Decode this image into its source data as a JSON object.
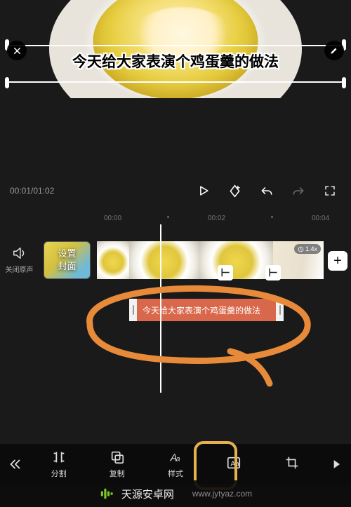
{
  "preview": {
    "subtitle_text": "今天给大家表演个鸡蛋羹的做法",
    "close_icon": "close-icon",
    "edit_icon": "pencil-icon"
  },
  "transport": {
    "current_time": "00:01",
    "total_time": "01:02",
    "separator": "/"
  },
  "ruler": {
    "marks": [
      "00:00",
      "00:02",
      "00:04"
    ]
  },
  "sound": {
    "label": "关闭原声"
  },
  "cover": {
    "label": "设置\n封面"
  },
  "clips": {
    "speed_badge": "1.4x"
  },
  "text_track": {
    "text": "今天给大家表演个鸡蛋羹的做法"
  },
  "toolbar": {
    "items": [
      {
        "label": "分割",
        "icon": "split-icon"
      },
      {
        "label": "复制",
        "icon": "copy-icon"
      },
      {
        "label": "样式",
        "icon": "style-icon"
      },
      {
        "label": "",
        "icon": "font-box-icon"
      },
      {
        "label": "",
        "icon": "crop-icon"
      }
    ]
  },
  "watermark": {
    "site_name": "天源安卓网",
    "site_url": "www.jytyaz.com"
  }
}
